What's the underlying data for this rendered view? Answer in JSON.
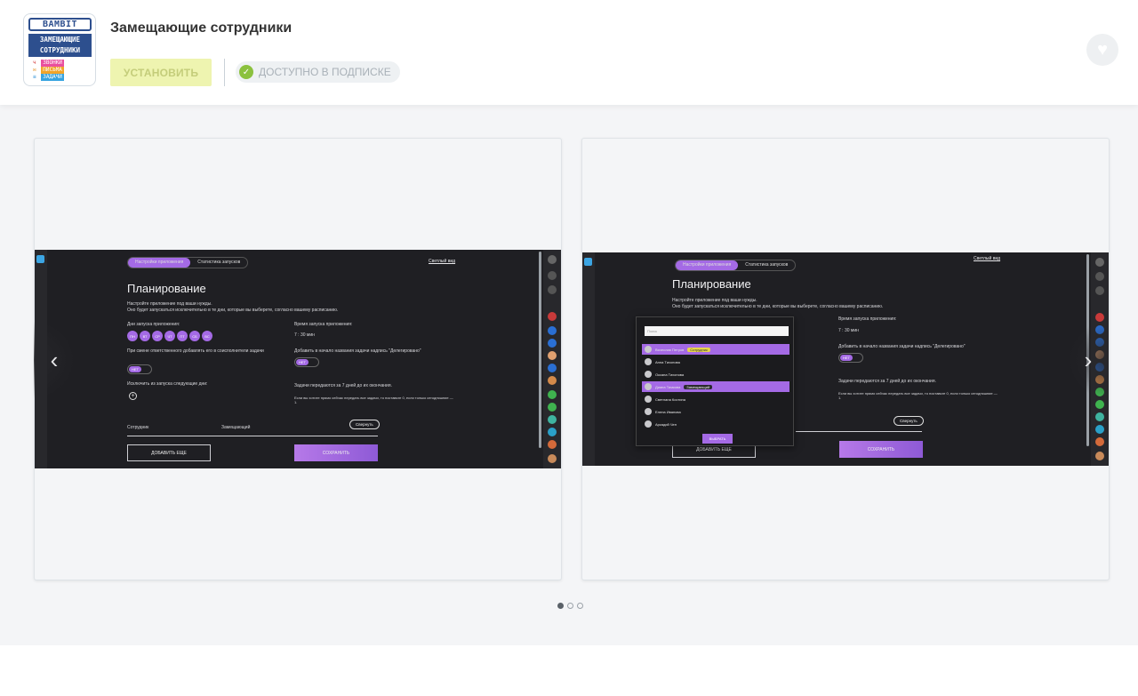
{
  "app": {
    "title": "Замещающие сотрудники",
    "install_label": "УСТАНОВИТЬ",
    "subscription_label": "ДОСТУПНО В ПОДПИСКЕ",
    "icon": {
      "brand": "BAMBIT",
      "banner_line1": "ЗАМЕЩАЮЩИЕ",
      "banner_line2": "СОТРУДНИКИ",
      "tags": [
        "ЗВОНКИ",
        "ПИСЬМА",
        "ЗАДАЧИ"
      ]
    }
  },
  "colors": {
    "install_bg": "#eef4b0",
    "check": "#8bc13e",
    "accent": "#a46ae5",
    "dark": "#1f1f23"
  },
  "gallery": {
    "pager": {
      "count": 3,
      "active": 0
    },
    "slide1": {
      "tab_settings": "Настройки приложения",
      "tab_stats": "Статистика запусков",
      "link_theme": "Светлый вид",
      "heading": "Планирование",
      "intro1": "Настройте приложение под ваши нужды.",
      "intro2": "Оно будет запускаться исключительно в те дни, которые вы выберете, согласно вашему расписанию.",
      "days_label": "Дни запуска приложения:",
      "days": [
        "ПН",
        "ВТ",
        "СР",
        "ЧТ",
        "ПТ",
        "СБ",
        "ВС"
      ],
      "time_label": "Время запуска приложения:",
      "time_value": "7 : 30 мин",
      "resp_label": "При смене ответственного добавлять его в соисполнители задачи",
      "toggle_no": "НЕТ",
      "prefix_label": "Добавить в начало названия задачи надпись \"Делегировано\"",
      "toggle_yes": "НЕТ",
      "exclude_label": "Исключить из запуска следующие дни:",
      "transfer_label": "Задачи передаются за 7 дней до их окончания.",
      "transfer_note": "Если вы хотите прямо сейчас передать все задачи, то поставьте 0, если только сегодняшние — 1.",
      "col_employee": "Сотрудник",
      "col_substitute": "Замещающий",
      "collapse": "Свернуть",
      "add_more": "ДОБАВИТЬ ЕЩЕ",
      "save": "СОХРАНИТЬ"
    },
    "slide2": {
      "search_placeholder": "Поиск",
      "people": [
        "Вячеслав Петров",
        "Анна Тихонова",
        "Оксана Тихонова",
        "Диана Тимкова",
        "Светлана Костина",
        "Елена Иванова",
        "Аркадий Чен"
      ],
      "tag_employee": "Сотрудник",
      "tag_sub": "Замещающий",
      "choose": "ВЫБРАТЬ"
    }
  }
}
